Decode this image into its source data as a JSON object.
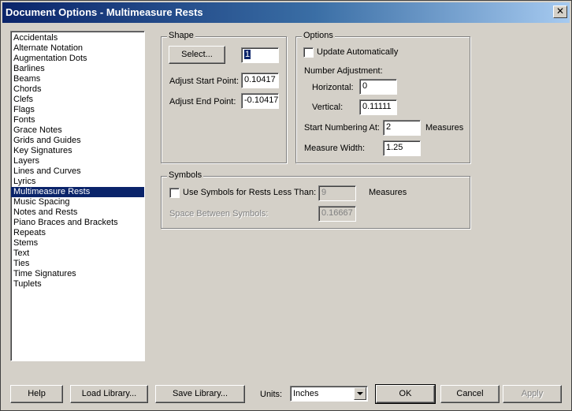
{
  "window": {
    "title": "Document Options - Multimeasure Rests",
    "close_glyph": "✕"
  },
  "sidebar": {
    "items": [
      "Accidentals",
      "Alternate Notation",
      "Augmentation Dots",
      "Barlines",
      "Beams",
      "Chords",
      "Clefs",
      "Flags",
      "Fonts",
      "Grace Notes",
      "Grids and Guides",
      "Key Signatures",
      "Layers",
      "Lines and Curves",
      "Lyrics",
      "Multimeasure Rests",
      "Music Spacing",
      "Notes and Rests",
      "Piano Braces and Brackets",
      "Repeats",
      "Stems",
      "Text",
      "Ties",
      "Time Signatures",
      "Tuplets"
    ],
    "selected_index": 15
  },
  "shape": {
    "title": "Shape",
    "select_button": "Select...",
    "shape_value": "1",
    "adjust_start_label": "Adjust Start Point:",
    "adjust_start_value": "0.10417",
    "adjust_end_label": "Adjust End Point:",
    "adjust_end_value": "-0.10417"
  },
  "options": {
    "title": "Options",
    "update_auto_label": "Update Automatically",
    "update_auto_checked": false,
    "number_adjustment_label": "Number Adjustment:",
    "horizontal_label": "Horizontal:",
    "horizontal_value": "0",
    "vertical_label": "Vertical:",
    "vertical_value": "0.11111",
    "start_numbering_label": "Start Numbering At:",
    "start_numbering_value": "2",
    "start_numbering_unit": "Measures",
    "measure_width_label": "Measure Width:",
    "measure_width_value": "1.25"
  },
  "symbols": {
    "title": "Symbols",
    "use_symbols_label": "Use Symbols for Rests Less Than:",
    "use_symbols_checked": false,
    "use_symbols_value": "9",
    "use_symbols_unit": "Measures",
    "space_between_label": "Space Between Symbols:",
    "space_between_value": "0.16667"
  },
  "footer": {
    "help": "Help",
    "load_library": "Load Library...",
    "save_library": "Save Library...",
    "units_label": "Units:",
    "units_value": "Inches",
    "ok": "OK",
    "cancel": "Cancel",
    "apply": "Apply"
  }
}
